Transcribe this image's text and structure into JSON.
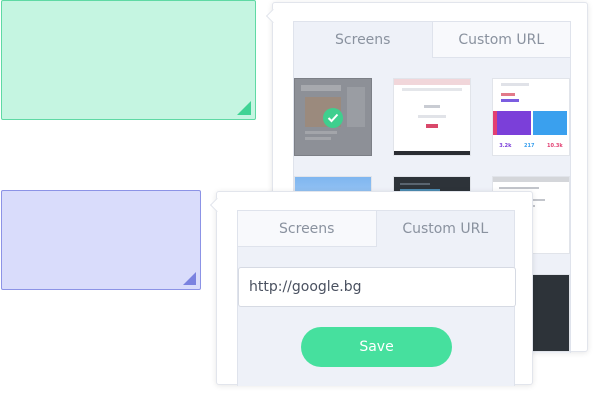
{
  "colors": {
    "green_card": "#c5f5e1",
    "blue_card": "#d9dcfb",
    "accent": "#46e09e",
    "check": "#3fcf8e"
  },
  "back_popover": {
    "tabs": [
      {
        "label": "Screens",
        "active": true
      },
      {
        "label": "Custom URL",
        "active": false
      }
    ],
    "thumbnails": [
      {
        "name": "thumb-1",
        "selected": true
      },
      {
        "name": "thumb-2",
        "selected": false
      },
      {
        "name": "thumb-3",
        "selected": false,
        "stats": [
          "3.2k",
          "217",
          "10.3k"
        ]
      },
      {
        "name": "thumb-4",
        "selected": false
      },
      {
        "name": "thumb-5",
        "selected": false
      },
      {
        "name": "thumb-6",
        "selected": false
      },
      {
        "name": "thumb-7",
        "selected": false
      },
      {
        "name": "thumb-8",
        "selected": false
      },
      {
        "name": "thumb-9",
        "selected": false
      }
    ]
  },
  "front_popover": {
    "tabs": [
      {
        "label": "Screens",
        "active": false
      },
      {
        "label": "Custom URL",
        "active": true
      }
    ],
    "url_value": "http://google.bg",
    "save_label": "Save"
  },
  "icons": {
    "check": "check-icon",
    "corner": "resize-corner-icon"
  }
}
